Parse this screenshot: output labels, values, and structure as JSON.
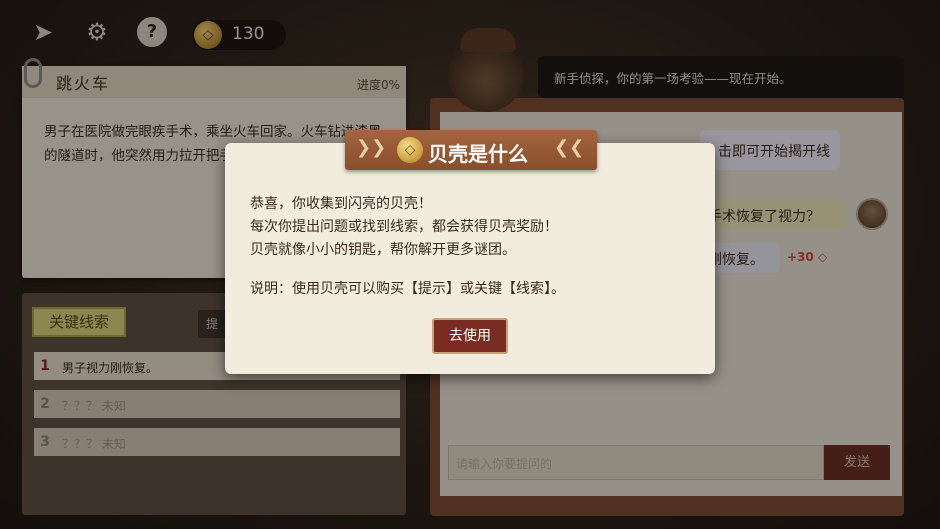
{
  "topbar": {
    "coins": "130"
  },
  "case": {
    "title": "跳火车",
    "progress": "进度0%",
    "text": "男子在医院做完眼疾手术，乘坐火车回家。火车钻进漆黑的隧道时，他突然用力拉开把手跳了下去，最"
  },
  "clues": {
    "header": "关键线索",
    "tab": "提",
    "items": [
      {
        "num": "1",
        "text": "男子视力刚恢复。"
      },
      {
        "num": "2",
        "text": "？？？ 未知"
      },
      {
        "num": "3",
        "text": "？？？ 未知"
      }
    ]
  },
  "chat": {
    "speech": "新手侦探，你的第一场考验——现在开始。",
    "bubble1": "击即可开始揭开线",
    "bubble2": "手术恢复了视力？",
    "bubble3": "刚恢复。",
    "reward": "+30",
    "input_placeholder": "请输入你要提问的",
    "send": "发送"
  },
  "modal": {
    "title": "贝壳是什么",
    "line1": "恭喜，你收集到闪亮的贝壳！",
    "line2": "每次你提出问题或找到线索，都会获得贝壳奖励！",
    "line3": "贝壳就像小小的钥匙，帮你解开更多谜团。",
    "note": "说明：使用贝壳可以购买【提示】或关键【线索】。",
    "button": "去使用"
  }
}
